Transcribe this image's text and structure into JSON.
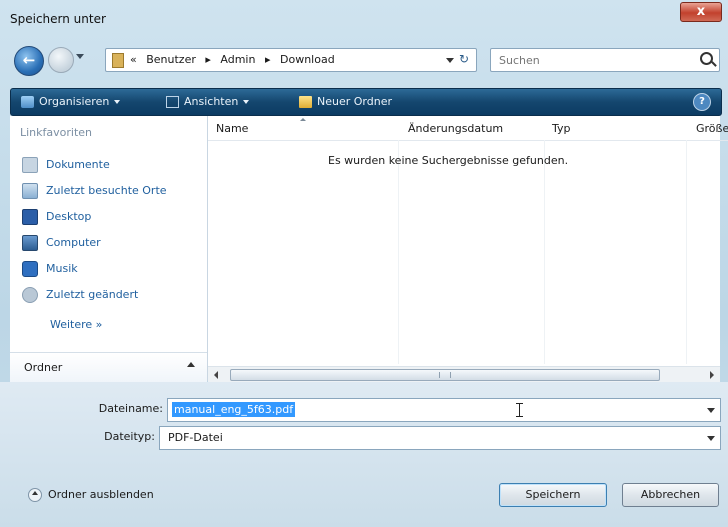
{
  "window": {
    "title": "Speichern unter",
    "close_label": "x"
  },
  "nav": {
    "back_label": "←",
    "breadcrumb": [
      "«",
      "Benutzer",
      "▸",
      "Admin",
      "▸",
      "Download"
    ],
    "search_placeholder": "Suchen",
    "refresh_icon": "↻"
  },
  "toolbar": {
    "organize_label": "Organisieren",
    "view_label": "Ansichten",
    "new_folder_label": "Neuer Ordner",
    "help_label": "?"
  },
  "sidebar": {
    "header": "Linkfavoriten",
    "items": [
      {
        "label": "Dokumente",
        "icon": "documents-icon"
      },
      {
        "label": "Zuletzt besuchte Orte",
        "icon": "recent-places-icon"
      },
      {
        "label": "Desktop",
        "icon": "desktop-icon"
      },
      {
        "label": "Computer",
        "icon": "computer-icon"
      },
      {
        "label": "Musik",
        "icon": "music-icon"
      },
      {
        "label": "Zuletzt geändert",
        "icon": "recently-changed-icon"
      }
    ],
    "more_label": "Weitere »",
    "folders_label": "Ordner"
  },
  "filelist": {
    "columns": [
      "Name",
      "Änderungsdatum",
      "Typ",
      "Größe"
    ],
    "empty_message": "Es wurden keine Suchergebnisse gefunden."
  },
  "form": {
    "filename_label": "Dateiname:",
    "filename_value": "manual_eng_5f63.pdf",
    "filetype_label": "Dateityp:",
    "filetype_value": "PDF-Datei",
    "hide_folders_label": "Ordner ausblenden",
    "save_label": "Speichern",
    "cancel_label": "Abbrechen"
  },
  "colors": {
    "toolbar_bg": "#14466e",
    "link": "#1f5f9e",
    "close": "#c2412d",
    "selection": "#3399ff"
  }
}
